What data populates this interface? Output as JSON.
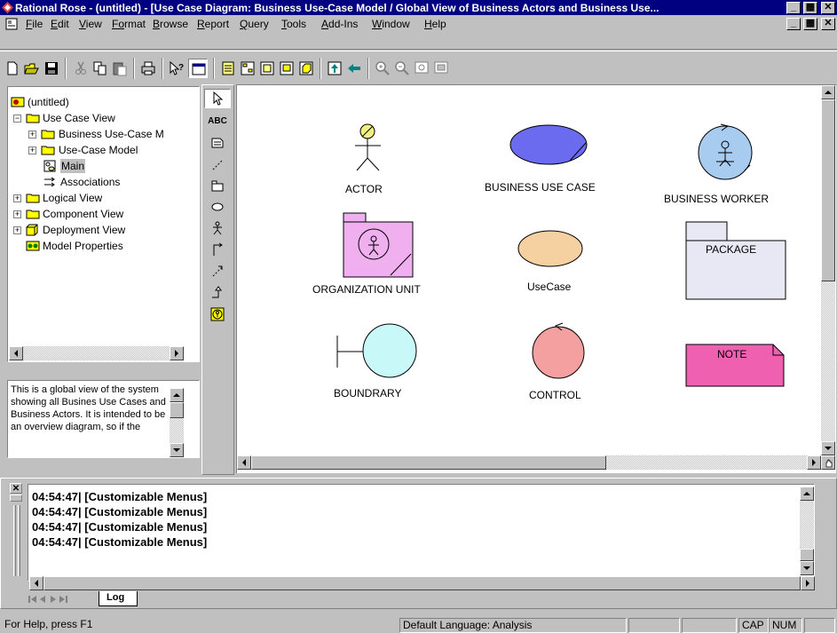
{
  "window": {
    "title": "Rational Rose - (untitled) - [Use Case Diagram: Business Use-Case Model / Global View of Business Actors and Business Use..."
  },
  "menu": {
    "items": [
      {
        "key": "F",
        "rest": "ile"
      },
      {
        "key": "E",
        "rest": "dit"
      },
      {
        "key": "V",
        "rest": "iew"
      },
      {
        "key": "Fo",
        "rest": "rmat",
        "pre": ""
      },
      {
        "key": "B",
        "rest": "rowse"
      },
      {
        "key": "R",
        "rest": "eport"
      },
      {
        "key": "Q",
        "rest": "uery"
      },
      {
        "key": "T",
        "rest": "ools"
      },
      {
        "key": "A",
        "rest": "dd-Ins"
      },
      {
        "key": "W",
        "rest": "indow"
      },
      {
        "key": "H",
        "rest": "elp"
      }
    ]
  },
  "browser": {
    "items": [
      {
        "label": "(untitled)"
      },
      {
        "label": "Use Case View"
      },
      {
        "label": "Business Use-Case M"
      },
      {
        "label": "Use-Case Model"
      },
      {
        "label": "Main"
      },
      {
        "label": "Associations"
      },
      {
        "label": "Logical View"
      },
      {
        "label": "Component View"
      },
      {
        "label": "Deployment View"
      },
      {
        "label": "Model Properties"
      }
    ]
  },
  "documentation": {
    "text": "This is a global view of the system showing all Busines Use Cases and Business Actors.  It is intended to be an overview diagram, so if the"
  },
  "toolbox": {
    "text_tool": "ABC"
  },
  "diagram": {
    "elements": [
      {
        "label": "ACTOR"
      },
      {
        "label": "BUSINESS USE CASE"
      },
      {
        "label": "BUSINESS WORKER"
      },
      {
        "label": "ORGANIZATION UNIT"
      },
      {
        "label": "UseCase"
      },
      {
        "label": "PACKAGE"
      },
      {
        "label": "BOUNDRARY"
      },
      {
        "label": "CONTROL"
      },
      {
        "label": "NOTE"
      }
    ],
    "colors": {
      "business_use_case": "#6b6bf0",
      "business_worker": "#a8ccf0",
      "organization_unit": "#f0b0f0",
      "use_case": "#f5d0a0",
      "package": "#e8e8f4",
      "boundary": "#c8f8f8",
      "control": "#f4a0a0",
      "note": "#f060b0"
    }
  },
  "log": {
    "lines": [
      "04:54:47|  [Customizable Menus]",
      "04:54:47|  [Customizable Menus]",
      "04:54:47|  [Customizable Menus]",
      "04:54:47|  [Customizable Menus]"
    ],
    "tab": "Log"
  },
  "status": {
    "help": "For Help, press F1",
    "language": "Default Language: Analysis",
    "cap": "CAP",
    "num": "NUM"
  }
}
